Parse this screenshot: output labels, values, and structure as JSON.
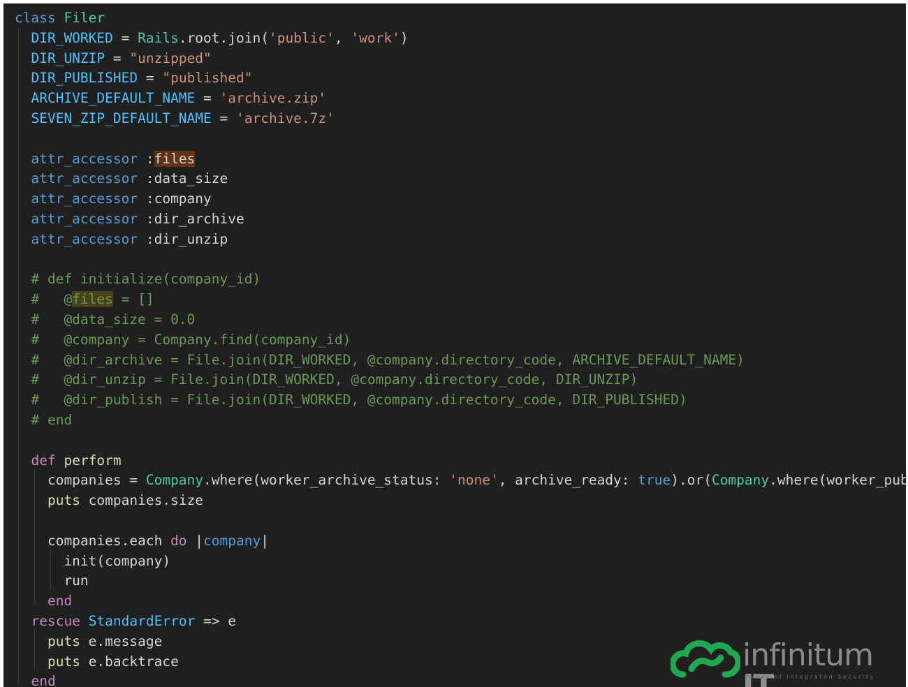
{
  "colors": {
    "background": "#1f1f1f",
    "keyword_blue": "#569cd6",
    "keyword_purple": "#c586c0",
    "class_name": "#4ec9b0",
    "constant": "#4fc1ff",
    "string": "#ce9178",
    "function": "#dcdcaa",
    "comment": "#6a9955",
    "text": "#d4d4d4",
    "logo_green": "#1fa84f"
  },
  "code": {
    "lines": [
      [
        {
          "t": "class",
          "c": "kw-blue"
        },
        {
          "t": " "
        },
        {
          "t": "Filer",
          "c": "class"
        }
      ],
      [
        {
          "t": "  "
        },
        {
          "t": "DIR_WORKED",
          "c": "const"
        },
        {
          "t": " = "
        },
        {
          "t": "Rails",
          "c": "class"
        },
        {
          "t": ".root.join("
        },
        {
          "t": "'public'",
          "c": "str"
        },
        {
          "t": ", "
        },
        {
          "t": "'work'",
          "c": "str"
        },
        {
          "t": ")"
        }
      ],
      [
        {
          "t": "  "
        },
        {
          "t": "DIR_UNZIP",
          "c": "const"
        },
        {
          "t": " = "
        },
        {
          "t": "\"unzipped\"",
          "c": "str"
        }
      ],
      [
        {
          "t": "  "
        },
        {
          "t": "DIR_PUBLISHED",
          "c": "const"
        },
        {
          "t": " = "
        },
        {
          "t": "\"published\"",
          "c": "str"
        }
      ],
      [
        {
          "t": "  "
        },
        {
          "t": "ARCHIVE_DEFAULT_NAME",
          "c": "const"
        },
        {
          "t": " = "
        },
        {
          "t": "'archive.zip'",
          "c": "str"
        }
      ],
      [
        {
          "t": "  "
        },
        {
          "t": "SEVEN_ZIP_DEFAULT_NAME",
          "c": "const"
        },
        {
          "t": " = "
        },
        {
          "t": "'archive.7z'",
          "c": "str"
        }
      ],
      [],
      [
        {
          "t": "  "
        },
        {
          "t": "attr_accessor",
          "c": "kw-blue"
        },
        {
          "t": " :"
        },
        {
          "t": "files",
          "hl": "word"
        }
      ],
      [
        {
          "t": "  "
        },
        {
          "t": "attr_accessor",
          "c": "kw-blue"
        },
        {
          "t": " :data_size"
        }
      ],
      [
        {
          "t": "  "
        },
        {
          "t": "attr_accessor",
          "c": "kw-blue"
        },
        {
          "t": " :company"
        }
      ],
      [
        {
          "t": "  "
        },
        {
          "t": "attr_accessor",
          "c": "kw-blue"
        },
        {
          "t": " :dir_archive"
        }
      ],
      [
        {
          "t": "  "
        },
        {
          "t": "attr_accessor",
          "c": "kw-blue"
        },
        {
          "t": " :dir_unzip"
        }
      ],
      [],
      [
        {
          "t": "  "
        },
        {
          "t": "# def initialize(company_id)",
          "c": "comment"
        }
      ],
      [
        {
          "t": "  "
        },
        {
          "t": "#   ",
          "c": "comment"
        },
        {
          "t": "@",
          "c": "comment"
        },
        {
          "t": "files",
          "c": "comment",
          "hl": "comment"
        },
        {
          "t": " = []",
          "c": "comment"
        }
      ],
      [
        {
          "t": "  "
        },
        {
          "t": "#   @data_size = 0.0",
          "c": "comment"
        }
      ],
      [
        {
          "t": "  "
        },
        {
          "t": "#   @company = Company.find(company_id)",
          "c": "comment"
        }
      ],
      [
        {
          "t": "  "
        },
        {
          "t": "#   @dir_archive = File.join(DIR_WORKED, @company.directory_code, ARCHIVE_DEFAULT_NAME)",
          "c": "comment"
        }
      ],
      [
        {
          "t": "  "
        },
        {
          "t": "#   @dir_unzip = File.join(DIR_WORKED, @company.directory_code, DIR_UNZIP)",
          "c": "comment"
        }
      ],
      [
        {
          "t": "  "
        },
        {
          "t": "#   @dir_publish = File.join(DIR_WORKED, @company.directory_code, DIR_PUBLISHED)",
          "c": "comment"
        }
      ],
      [
        {
          "t": "  "
        },
        {
          "t": "# end",
          "c": "comment"
        }
      ],
      [],
      [
        {
          "t": "  "
        },
        {
          "t": "def",
          "c": "kw-purple"
        },
        {
          "t": " "
        },
        {
          "t": "perform",
          "c": "func"
        }
      ],
      [
        {
          "t": "    companies = "
        },
        {
          "t": "Company",
          "c": "class"
        },
        {
          "t": ".where(worker_archive_status: "
        },
        {
          "t": "'none'",
          "c": "str"
        },
        {
          "t": ", archive_ready: "
        },
        {
          "t": "true",
          "c": "kw-blue"
        },
        {
          "t": ").or("
        },
        {
          "t": "Company",
          "c": "class"
        },
        {
          "t": ".where(worker_publis"
        }
      ],
      [
        {
          "t": "    "
        },
        {
          "t": "puts",
          "c": "func"
        },
        {
          "t": " companies.size"
        }
      ],
      [],
      [
        {
          "t": "    companies.each "
        },
        {
          "t": "do",
          "c": "kw-purple"
        },
        {
          "t": " |"
        },
        {
          "t": "company",
          "c": "kw-blue"
        },
        {
          "t": "|"
        }
      ],
      [
        {
          "t": "      init(company)"
        }
      ],
      [
        {
          "t": "      run"
        }
      ],
      [
        {
          "t": "    "
        },
        {
          "t": "end",
          "c": "kw-purple"
        }
      ],
      [
        {
          "t": "  "
        },
        {
          "t": "rescue",
          "c": "kw-purple"
        },
        {
          "t": " "
        },
        {
          "t": "StandardError",
          "c": "const"
        },
        {
          "t": " => e"
        }
      ],
      [
        {
          "t": "    "
        },
        {
          "t": "puts",
          "c": "func"
        },
        {
          "t": " e.message"
        }
      ],
      [
        {
          "t": "    "
        },
        {
          "t": "puts",
          "c": "func"
        },
        {
          "t": " e.backtrace"
        }
      ],
      [
        {
          "t": "  "
        },
        {
          "t": "end",
          "c": "kw-purple"
        }
      ]
    ]
  },
  "watermark": {
    "name": "infinitum",
    "name_bold": "IT",
    "tagline": "Power of integrated Security"
  }
}
